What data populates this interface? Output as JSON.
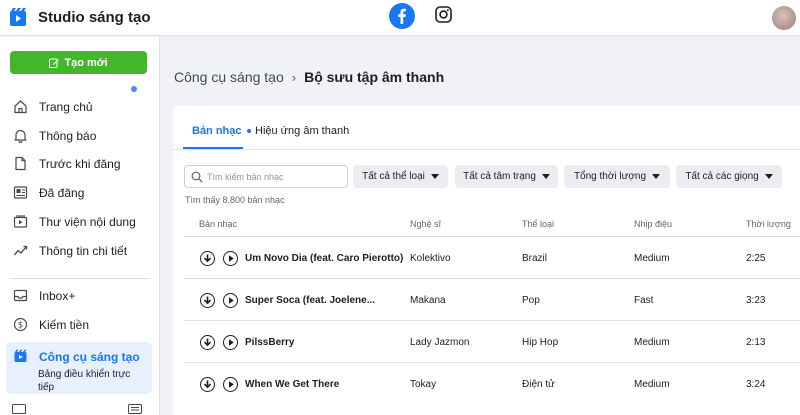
{
  "app": {
    "title": "Studio sáng tạo"
  },
  "sidebar": {
    "create_label": "Tạo mới",
    "items": [
      {
        "label": "Trang chủ",
        "icon": "home-icon"
      },
      {
        "label": "Thông báo",
        "icon": "bell-icon"
      },
      {
        "label": "Trước khi đăng",
        "icon": "document-icon"
      },
      {
        "label": "Đã đăng",
        "icon": "posts-icon"
      },
      {
        "label": "Thư viện nội dung",
        "icon": "library-icon"
      },
      {
        "label": "Thông tin chi tiết",
        "icon": "insights-icon"
      },
      {
        "label": "Inbox+",
        "icon": "inbox-icon"
      },
      {
        "label": "Kiếm tiền",
        "icon": "dollar-icon"
      }
    ],
    "active": {
      "label": "Công cụ sáng tạo",
      "icon": "creator-tools-icon",
      "sub_label": "Bảng điều khiển trực tiếp"
    }
  },
  "breadcrumb": {
    "parent": "Công cụ sáng tạo",
    "current": "Bộ sưu tập âm thanh"
  },
  "tabs": {
    "music": "Bản nhạc",
    "sound_effects": "Hiệu ứng âm thanh"
  },
  "search": {
    "placeholder": "Tìm kiếm bản nhạc"
  },
  "filters": {
    "genre": "Tất cả thể loại",
    "mood": "Tất cả tâm trạng",
    "duration": "Tổng thời lượng",
    "vocals": "Tất cả các giọng"
  },
  "result_count": "Tìm thấy 8.800 bản nhạc",
  "table": {
    "headers": {
      "track": "Bản nhạc",
      "artist": "Nghệ sĩ",
      "genre": "Thể loại",
      "tempo": "Nhịp điệu",
      "duration": "Thời lượng"
    },
    "rows": [
      {
        "title": "Um Novo Dia (feat. Caro Pierotto)",
        "artist": "Kolektivo",
        "genre": "Brazil",
        "tempo": "Medium",
        "duration": "2:25"
      },
      {
        "title": "Super Soca (feat. Joelene...",
        "artist": "Makana",
        "genre": "Pop",
        "tempo": "Fast",
        "duration": "3:23"
      },
      {
        "title": "PilssBerry",
        "artist": "Lady Jazmon",
        "genre": "Hip Hop",
        "tempo": "Medium",
        "duration": "2:13"
      },
      {
        "title": "When We Get There",
        "artist": "Tokay",
        "genre": "Điện tử",
        "tempo": "Medium",
        "duration": "3:24"
      }
    ]
  },
  "colors": {
    "brand_blue": "#1877f2",
    "create_green": "#42b72a",
    "active_bg": "#e7f0fd"
  }
}
